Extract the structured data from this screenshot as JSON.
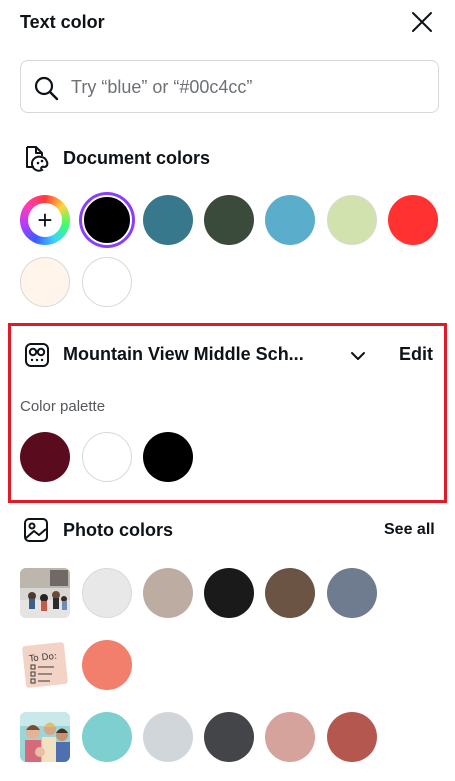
{
  "panel": {
    "title": "Text color"
  },
  "search": {
    "placeholder": "Try “blue” or “#00c4cc”"
  },
  "document_colors": {
    "title": "Document colors",
    "add_button_symbol": "+",
    "swatches": [
      "#000000",
      "#37788c",
      "#3b4b3b",
      "#5baecb",
      "#d2e2ae",
      "#ff3131",
      "#fff5ea",
      "#ffffff"
    ],
    "selected": "#000000"
  },
  "brand_kit": {
    "name": "Mountain View Middle Sch...",
    "edit_label": "Edit",
    "palette_label": "Color palette",
    "swatches": [
      "#5a0b1e",
      "#ffffff",
      "#000000"
    ]
  },
  "photo_colors": {
    "title": "Photo colors",
    "see_all_label": "See all",
    "rows": [
      {
        "thumb": "classroom-photo",
        "colors": [
          "#e8e8e8",
          "#bcaca2",
          "#1a1a1a",
          "#6b5444",
          "#6f7b8e"
        ]
      },
      {
        "thumb": "todo-note-photo",
        "colors": [
          "#f27e6c"
        ]
      },
      {
        "thumb": "students-photo",
        "colors": [
          "#7ecfd0",
          "#d0d6da",
          "#444549",
          "#d5a39b",
          "#b4584f"
        ]
      }
    ]
  },
  "accent": {
    "highlight_box": "#e21a25",
    "selected_ring": "#8b3dff"
  }
}
